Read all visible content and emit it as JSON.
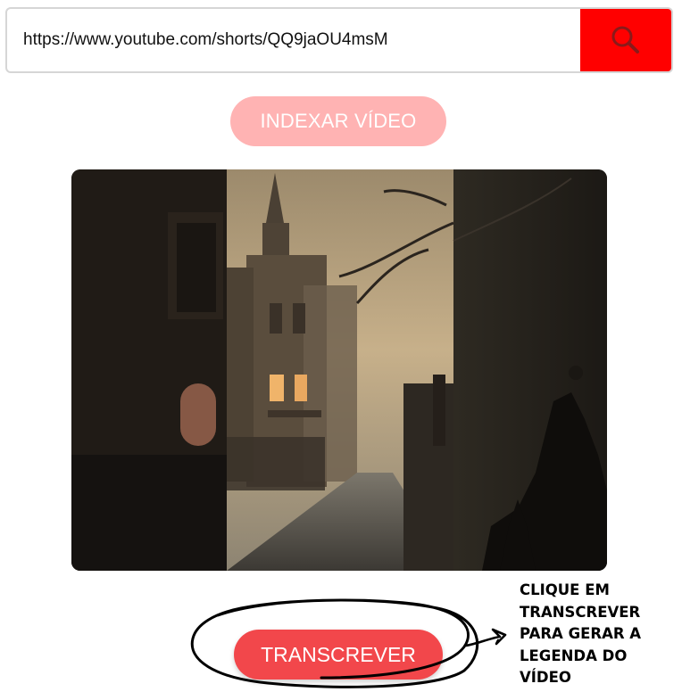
{
  "search": {
    "value": "https://www.youtube.com/shorts/QQ9jaOU4msM",
    "button_icon": "search-icon"
  },
  "index_button": {
    "label": "INDEXAR VÍDEO"
  },
  "thumbnail": {
    "content": "foggy-gothic-street-image"
  },
  "transcribe_button": {
    "label": "TRANSCREVER"
  },
  "annotation": {
    "lines": [
      "CLIQUE EM",
      "TRANSCREVER",
      "PARA GERAR A",
      "LEGENDA DO",
      "VÍDEO"
    ]
  },
  "colors": {
    "search_button": "#ff0000",
    "index_button": "#ffb3b3",
    "transcribe_button": "#f2474b"
  }
}
